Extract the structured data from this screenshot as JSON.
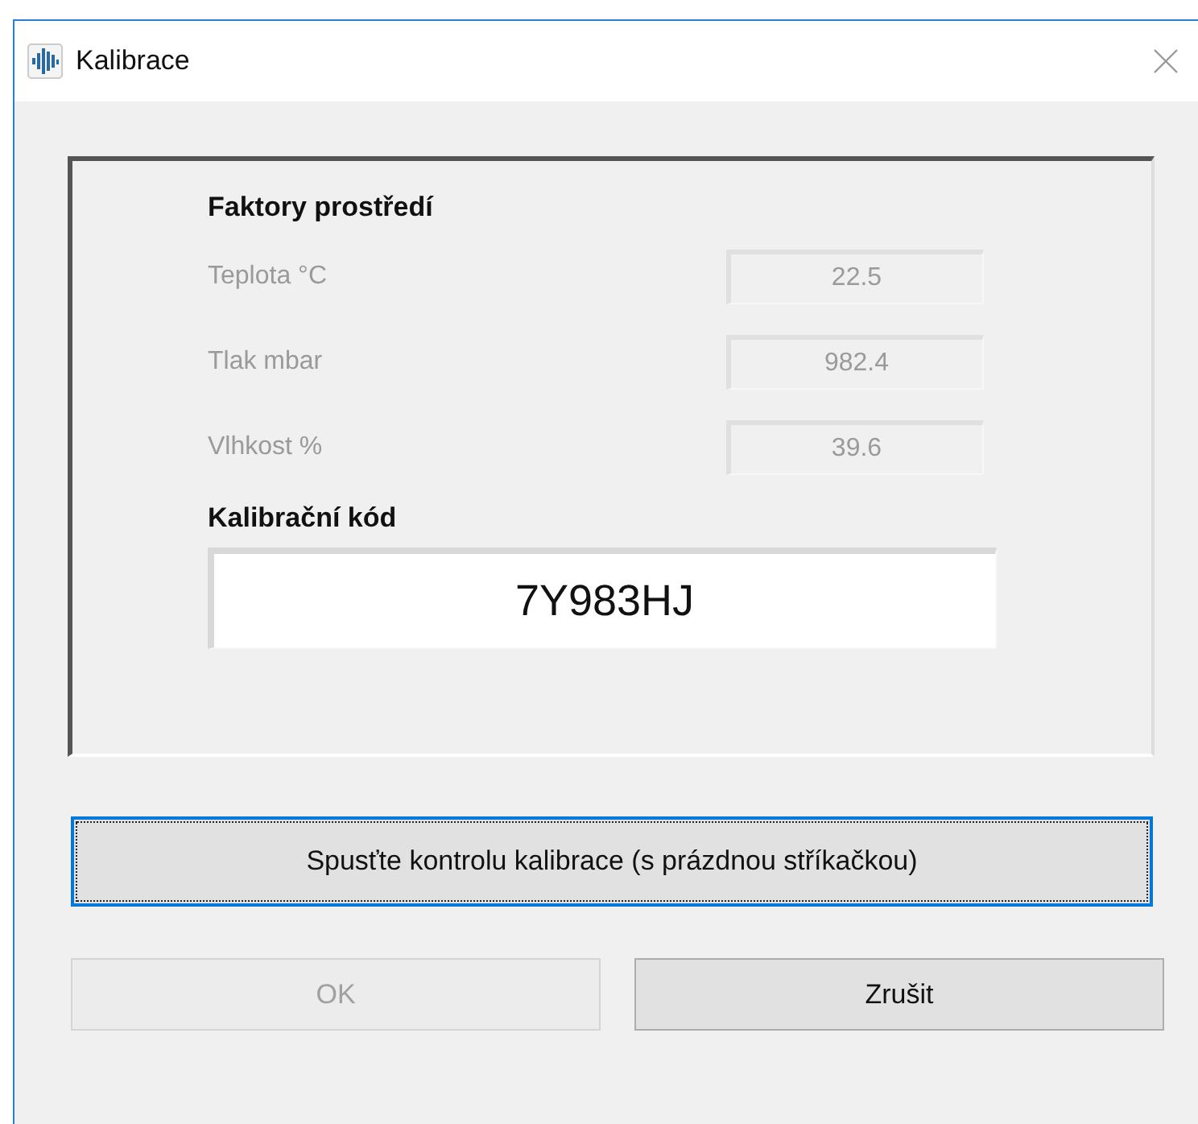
{
  "window": {
    "title": "Kalibrace"
  },
  "environment": {
    "heading": "Faktory prostředí",
    "rows": [
      {
        "label": "Teplota °C",
        "value": "22.5",
        "disabled": true
      },
      {
        "label": "Tlak mbar",
        "value": "982.4",
        "disabled": true
      },
      {
        "label": "Vlhkost %",
        "value": "39.6",
        "disabled": true
      }
    ]
  },
  "calibration_code": {
    "heading": "Kalibrační kód",
    "value": "7Y983HJ"
  },
  "check_button": {
    "label": "Spusťte kontrolu kalibrace (s prázdnou stříkačkou)",
    "focused": true
  },
  "buttons": [
    {
      "label": "OK",
      "disabled": true
    },
    {
      "label": "Zrušit",
      "disabled": false
    }
  ]
}
